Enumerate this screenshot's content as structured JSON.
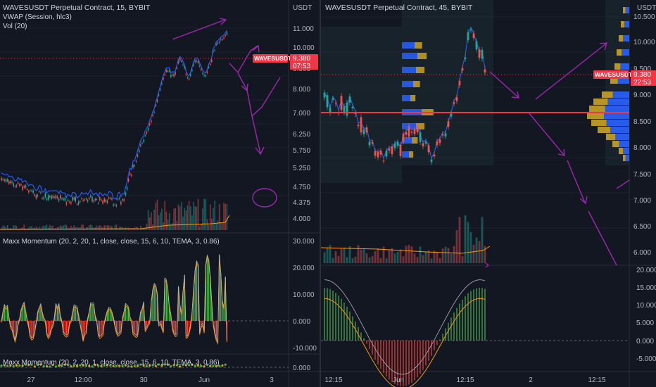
{
  "colors": {
    "bg": "#131722",
    "up": "#26a69a",
    "down": "#ef5350",
    "vwap": "#2962ff",
    "drawing": "#9c27b0",
    "hline": "#f23645",
    "vol_ma": "#ff9800",
    "grid": "#1e222d",
    "text": "#b2b5be",
    "scale_border": "#2a2e39",
    "vp_up": "#2962ff",
    "vp_down": "#c9a227",
    "osc_green": "#4caf50",
    "osc_red": "#f44336"
  },
  "left": {
    "title": "WAVESUSDT Perpetual Contract, 15, BYBIT",
    "vwap_label": "VWAP (Session, hlc3)",
    "vol_label": "Vol (20)",
    "currency": "USDT",
    "price_ticks": [
      "11.000",
      "10.000",
      "9.000",
      "8.000",
      "7.000",
      "6.250",
      "5.750",
      "5.250",
      "4.750",
      "4.375",
      "4.000"
    ],
    "symbol_tag": "WAVESUSDT",
    "price_value": "9.380",
    "countdown": "07:53",
    "osc1_label": "Maxx Momentum (20, 2, 20, 1, close, close, 15, 6, 10, TEMA, 3, 0.86)",
    "osc1_ticks": [
      "30.000",
      "20.000",
      "10.000",
      "0.000",
      "-10.000"
    ],
    "osc2_label": "Maxx Momentum (20, 2, 20, 1, close, close, 15, 6, 10, TEMA, 3, 0.86)",
    "osc2_ticks": [
      "0.000"
    ],
    "time_ticks": [
      "27",
      "12:00",
      "30",
      "Jun",
      "3"
    ]
  },
  "right": {
    "title": "WAVESUSDT Perpetual Contract, 45, BYBIT",
    "currency": "USDT",
    "price_ticks": [
      "10.500",
      "10.000",
      "9.500",
      "9.000",
      "8.500",
      "8.000",
      "7.500",
      "7.000",
      "6.500",
      "6.000"
    ],
    "symbol_tag": "WAVESUSDT",
    "price_value": "9.380",
    "countdown": "22:53",
    "osc_ticks": [
      "20.000",
      "15.000",
      "10.000",
      "5.000",
      "0.000",
      "-5.000"
    ],
    "time_ticks": [
      "12:15",
      "Jun",
      "12:15",
      "2",
      "12:15"
    ]
  }
}
